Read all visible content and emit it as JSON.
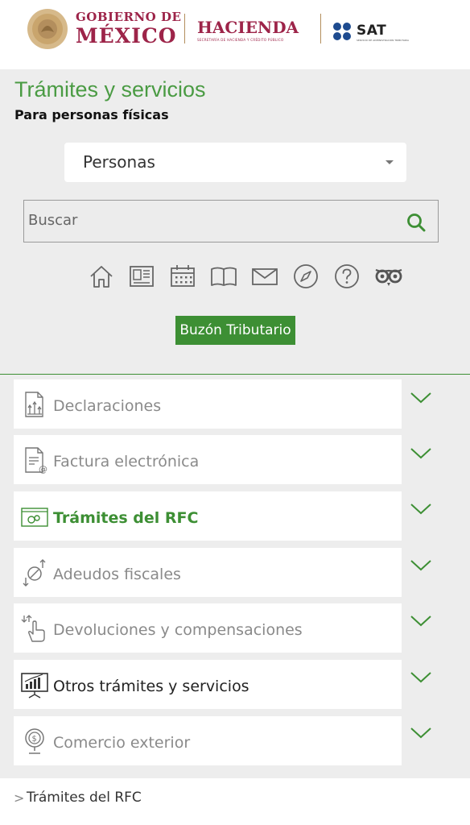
{
  "header": {
    "gobierno_line1": "GOBIERNO DE",
    "gobierno_line2": "MÉXICO",
    "hacienda": "HACIENDA",
    "hacienda_sub": "SECRETARÍA DE HACIENDA Y CRÉDITO PÚBLICO",
    "sat": "SAT",
    "sat_sub": "SERVICIO DE ADMINISTRACIÓN TRIBUTARIA",
    "brand_color": "#9d2449"
  },
  "panel": {
    "title": "Trámites y servicios",
    "subtitle": "Para personas físicas",
    "select_value": "Personas",
    "search_placeholder": "Buscar",
    "buzon_label": "Buzón Tributario",
    "accent_color": "#3d8f34"
  },
  "icons": [
    "home-icon",
    "newspaper-icon",
    "calendar-icon",
    "book-icon",
    "mail-icon",
    "compass-icon",
    "help-icon",
    "owl-icon"
  ],
  "accordion": [
    {
      "label": "Declaraciones",
      "icon": "declarations-icon",
      "state": "normal"
    },
    {
      "label": "Factura electrónica",
      "icon": "invoice-icon",
      "state": "normal"
    },
    {
      "label": "Trámites del RFC",
      "icon": "rfc-icon",
      "state": "active"
    },
    {
      "label": "Adeudos fiscales",
      "icon": "debt-icon",
      "state": "normal"
    },
    {
      "label": "Devoluciones y compensaciones",
      "icon": "refund-icon",
      "state": "normal"
    },
    {
      "label": "Otros trámites y servicios",
      "icon": "other-services-icon",
      "state": "dark"
    },
    {
      "label": "Comercio exterior",
      "icon": "foreign-trade-icon",
      "state": "normal"
    }
  ],
  "breadcrumb": {
    "arrow": ">",
    "current": "Trámites del RFC"
  }
}
